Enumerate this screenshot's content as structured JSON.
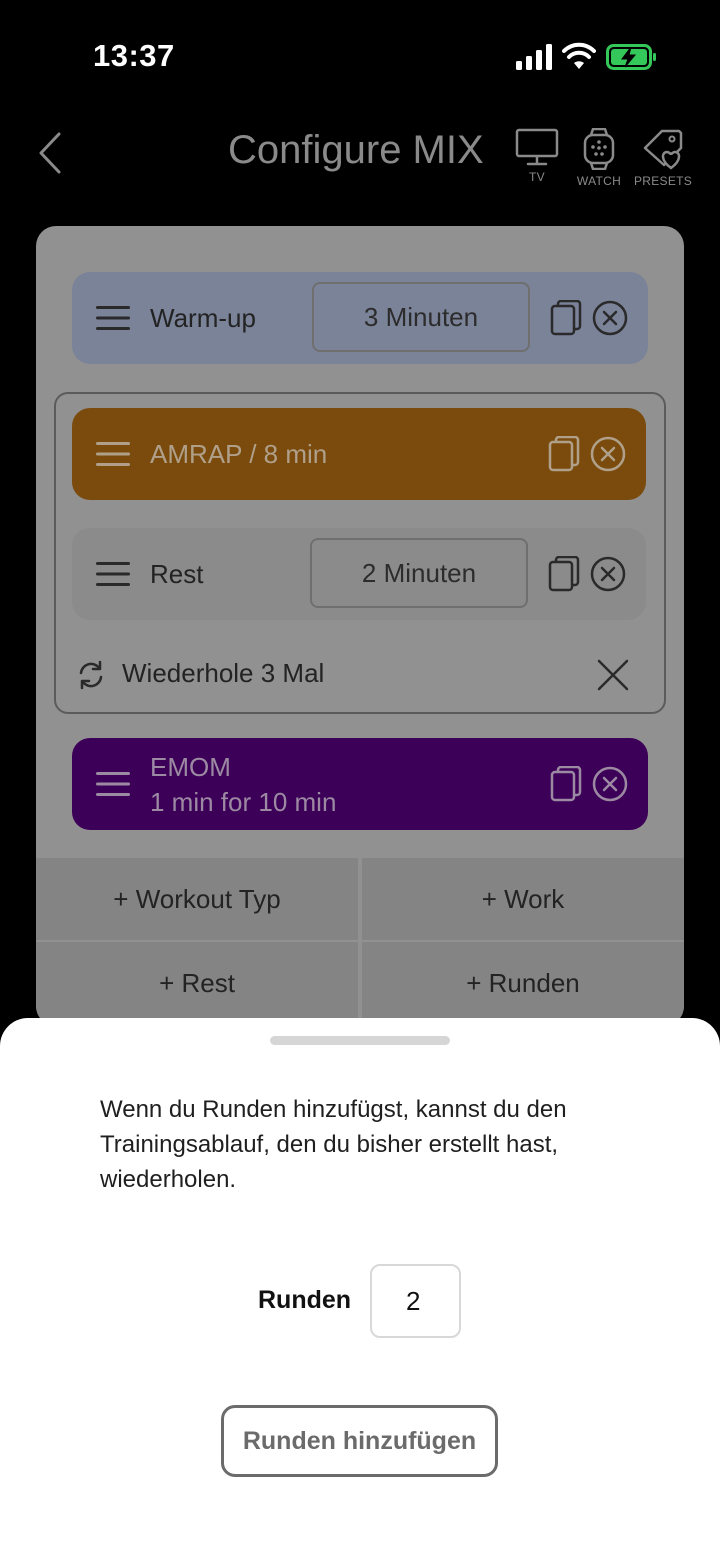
{
  "status_bar": {
    "time": "13:37",
    "icons": [
      "cellular-signal-icon",
      "wifi-icon",
      "battery-charging-icon"
    ]
  },
  "header": {
    "title": "Configure MIX",
    "back_icon": "chevron-left-icon",
    "actions": [
      {
        "label": "TV",
        "icon": "tv-icon"
      },
      {
        "label": "WATCH",
        "icon": "watch-icon"
      },
      {
        "label": "PRESETS",
        "icon": "tag-heart-icon"
      }
    ]
  },
  "blocks": {
    "warmup": {
      "label": "Warm-up",
      "duration": "3 Minuten",
      "color": "#7b8399"
    },
    "amrap": {
      "label": "AMRAP / 8 min",
      "color": "#7a4b0c"
    },
    "rest": {
      "label": "Rest",
      "duration": "2 Minuten",
      "color": "#8b8b8b"
    },
    "repeat": {
      "label": "Wiederhole 3 Mal"
    },
    "emom": {
      "line1": "EMOM",
      "line2": "1 min for 10 min",
      "color": "#3d0058"
    }
  },
  "add_buttons": {
    "workout_type": "+ Workout Typ",
    "work": "+ Work",
    "rest": "+ Rest",
    "rounds": "+ Runden"
  },
  "sheet": {
    "description": "Wenn du Runden hinzufügst, kannst du den Trainingsablauf, den du bisher erstellt hast, wiederholen.",
    "rounds_label": "Runden",
    "rounds_value": "2",
    "submit_label": "Runden hinzufügen"
  }
}
